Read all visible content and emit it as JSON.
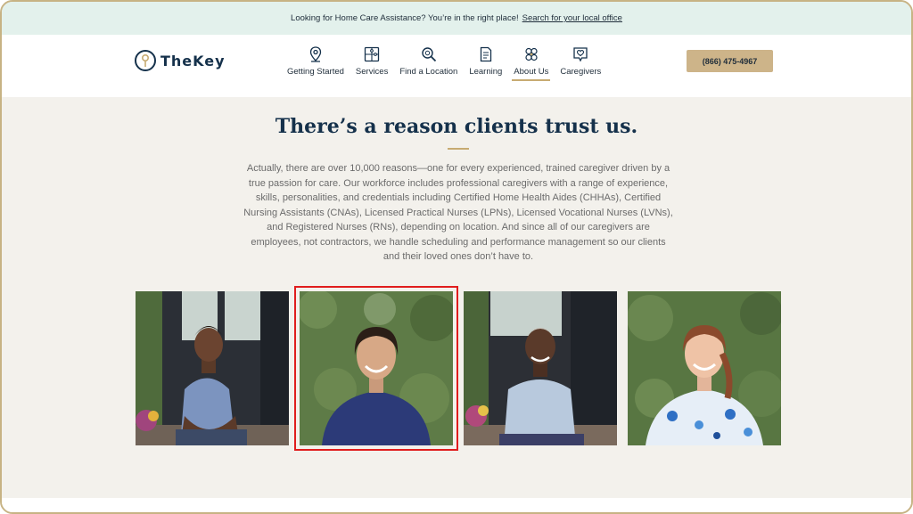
{
  "announcement": {
    "text": "Looking for Home Care Assistance? You’re in the right place!",
    "link": "Search for your local office"
  },
  "logo": {
    "text": "TheKey"
  },
  "nav": {
    "items": [
      {
        "label": "Getting Started",
        "icon": "location-pin-icon"
      },
      {
        "label": "Services",
        "icon": "puzzle-icon"
      },
      {
        "label": "Find a Location",
        "icon": "magnifier-icon"
      },
      {
        "label": "Learning",
        "icon": "document-icon"
      },
      {
        "label": "About Us",
        "icon": "team-icon",
        "active": true
      },
      {
        "label": "Caregivers",
        "icon": "heart-badge-icon"
      }
    ]
  },
  "phone": {
    "label": "(866) 475-4967"
  },
  "main": {
    "headline": "There’s a reason clients trust us.",
    "body": "Actually, there are over 10,000 reasons—one for every experienced, trained caregiver driven by a true passion for care. Our workforce includes professional caregivers with a range of experience, skills, personalities, and credentials including Certified Home Health Aides (CHHAs), Certified Nursing Assistants (CNAs), Licensed Practical Nurses (LPNs), Licensed Vocational Nurses (LVNs), and Registered Nurses (RNs), depending on location. And since all of our caregivers are employees, not contractors, we handle scheduling and performance management so our clients and their loved ones don’t have to."
  },
  "photos": [
    {
      "subject": "caregiver-man-blue-shirt"
    },
    {
      "subject": "caregiver-woman-navy-top",
      "selected": true
    },
    {
      "subject": "caregiver-woman-light-blue-polo"
    },
    {
      "subject": "caregiver-woman-floral-scrubs"
    }
  ],
  "colors": {
    "announce_bg": "#e3f1ec",
    "brand_navy": "#15314b",
    "accent_gold": "#cdb489",
    "page_bg": "#f3f1ec",
    "selection": "#e01d1d"
  }
}
